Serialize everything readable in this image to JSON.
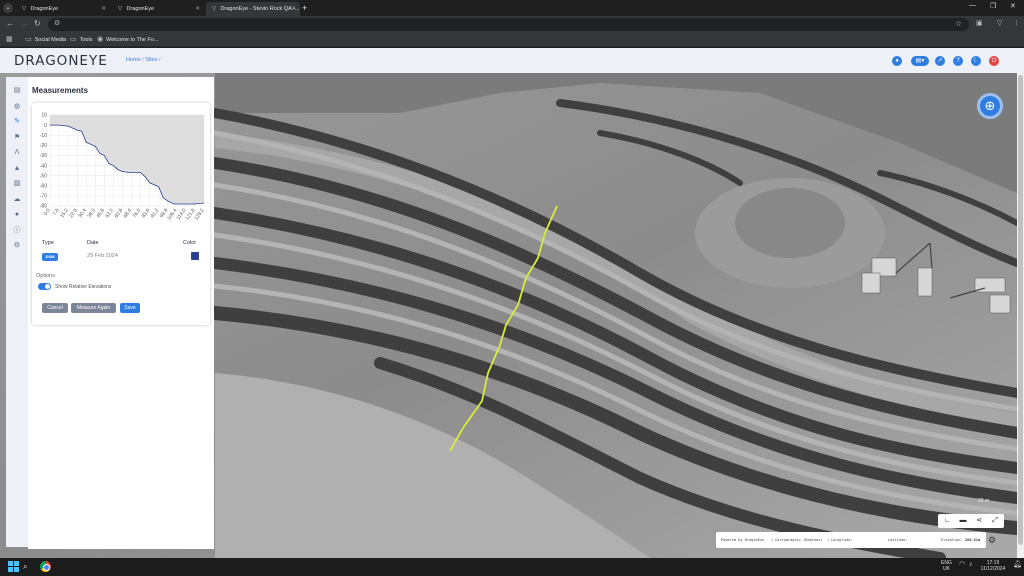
{
  "browser": {
    "tabs": [
      {
        "title": "DragonEye",
        "active": false
      },
      {
        "title": "DragonEye",
        "active": false
      },
      {
        "title": "DragonEye - Stevin Rock QA -...",
        "active": true
      }
    ],
    "bookmarks": [
      {
        "label": "Social Media",
        "icon": "folder-icon"
      },
      {
        "label": "Tools",
        "icon": "folder-icon"
      },
      {
        "label": "Welcome to The Fo...",
        "icon": "site-icon"
      }
    ]
  },
  "app": {
    "logo": "DRAGONEYE",
    "breadcrumb": {
      "home": "Home",
      "sep1": "/",
      "sites": "Sites",
      "sep2": "/"
    }
  },
  "panel": {
    "title": "Measurements",
    "columns": {
      "type": "Type",
      "date": "Date",
      "color": "Color"
    },
    "row": {
      "type": "DSM",
      "date": "29 Feb 2024",
      "color": "#2c3e8f"
    },
    "options_label": "Options",
    "toggle_label": "Show Relative Elevations",
    "toggle_on": true,
    "buttons": {
      "cancel": "Cancel",
      "measure_again": "Measure Again",
      "save": "Save"
    }
  },
  "chart_data": {
    "type": "area",
    "title": "",
    "xlabel": "",
    "ylabel": "",
    "ylim": [
      -80,
      10
    ],
    "yticks": [
      10,
      0,
      -10,
      -20,
      -30,
      -40,
      -50,
      -60,
      -70,
      -80
    ],
    "xticks": [
      "0.0",
      "7.6",
      "15.2",
      "22.8",
      "30.4",
      "38.0",
      "45.6",
      "53.2",
      "60.8",
      "68.4",
      "76.0",
      "83.6",
      "91.2",
      "98.8",
      "106.4",
      "114.0",
      "121.6",
      "129.2"
    ],
    "x": [
      0,
      7.6,
      15.2,
      19,
      22.8,
      26.6,
      30.4,
      34.2,
      38.0,
      41.8,
      45.6,
      49.4,
      53.2,
      57,
      60.8,
      68.4,
      76.0,
      79.8,
      83.6,
      87.4,
      91.2,
      95,
      98.8,
      104,
      110,
      114.0,
      121.6,
      129.2
    ],
    "y": [
      0,
      0,
      -1,
      -3,
      -5,
      -6,
      -17,
      -19,
      -21,
      -28,
      -30,
      -38,
      -40,
      -44,
      -46,
      -47,
      -47,
      -51,
      -57,
      -59,
      -61,
      -72,
      -75,
      -78,
      -78,
      -78,
      -78,
      -77
    ],
    "grid": true
  },
  "map": {
    "scale_label": "20 m",
    "status": {
      "powered_by": "Powered by DragonEye",
      "sep1": "|",
      "coords": "Cartographic (Degrees)",
      "sep2": "|",
      "longitude": "Longitude:",
      "latitude": "Latitude:",
      "elevation_label": "Elevation:",
      "elevation_value": "266.81m"
    }
  },
  "taskbar": {
    "lang1": "ENG",
    "lang2": "UK",
    "time": "17:19",
    "date": "11/12/2024"
  }
}
